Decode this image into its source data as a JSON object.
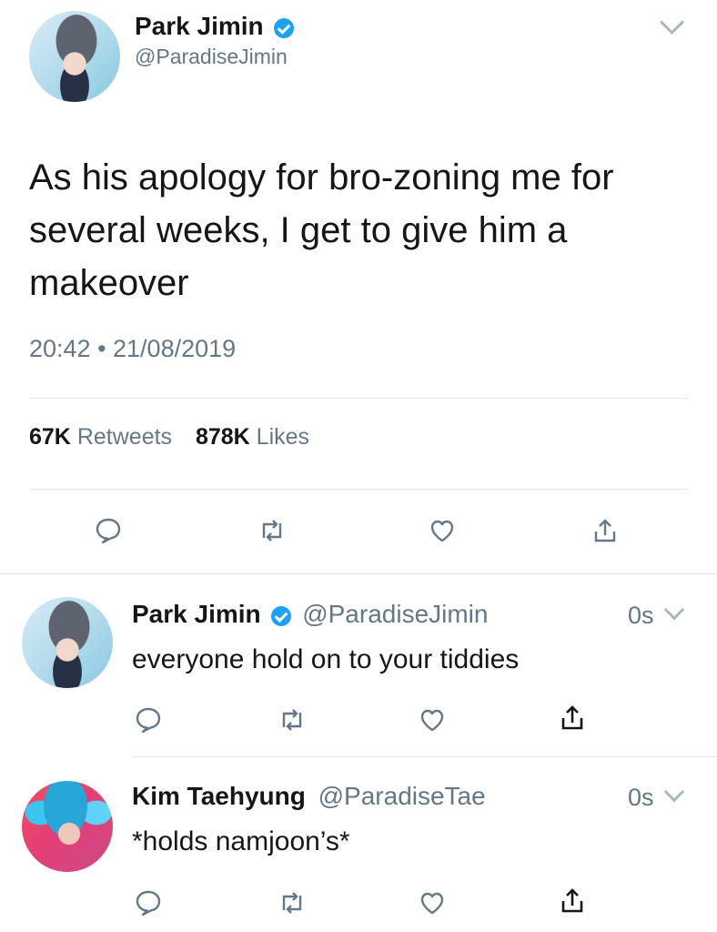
{
  "main_tweet": {
    "author": {
      "display_name": "Park Jimin",
      "handle": "@ParadiseJimin",
      "verified": true
    },
    "text_lines": [
      "As his apology for bro-zoning me for",
      "several weeks, I get to give him a",
      "makeover"
    ],
    "timestamp": "20:42 • 21/08/2019",
    "stats": {
      "retweets_count": "67K",
      "retweets_label": "Retweets",
      "likes_count": "878K",
      "likes_label": "Likes"
    },
    "actions": [
      "reply-icon",
      "retweet-icon",
      "like-icon",
      "share-icon"
    ]
  },
  "replies": [
    {
      "display_name": "Park Jimin",
      "handle": "@ParadiseJimin",
      "verified": true,
      "time": "0s",
      "text": "everyone hold on to your tiddies"
    },
    {
      "display_name": "Kim Taehyung",
      "handle": "@ParadiseTae",
      "verified": false,
      "time": "0s",
      "text": "*holds namjoon’s*"
    }
  ],
  "colors": {
    "text": "#14171a",
    "secondary": "#657786",
    "verified": "#1da1f2",
    "divider": "#e1e8ed",
    "icon": "#657786"
  }
}
